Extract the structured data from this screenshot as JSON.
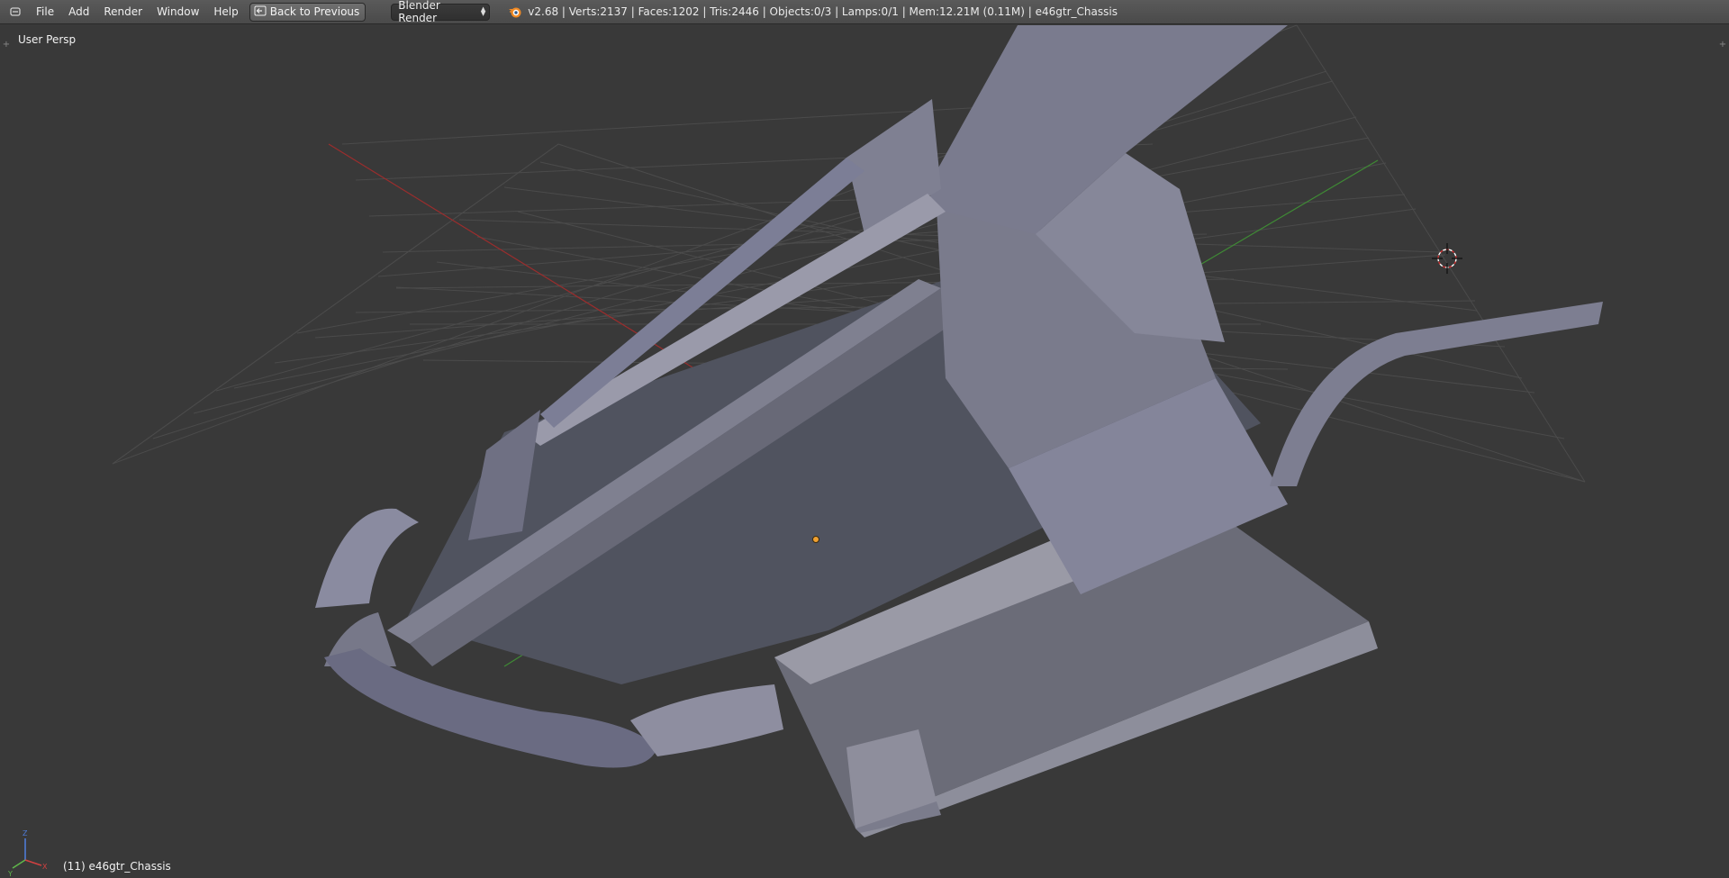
{
  "menu": {
    "file": "File",
    "add": "Add",
    "render": "Render",
    "window": "Window",
    "help": "Help",
    "back_button": "Back to Previous"
  },
  "render_engine": {
    "selected": "Blender Render"
  },
  "stats_text": "v2.68 | Verts:2137 | Faces:1202 | Tris:2446 | Objects:0/3 | Lamps:0/1 | Mem:12.21M (0.11M) | e46gtr_Chassis",
  "viewport": {
    "view_name": "User Persp",
    "object_info": "(11) e46gtr_Chassis",
    "axis_labels": {
      "x": "X",
      "y": "Y",
      "z": "Z"
    }
  },
  "icons": [
    "editor-type-icon",
    "back-arrow-icon",
    "blender-logo-icon",
    "3d-cursor-icon",
    "origin-dot-icon",
    "axis-gizmo-icon"
  ],
  "colors": {
    "header_bg": "#4d4d4d",
    "viewport_bg": "#393939",
    "grid": "#4a4a4a",
    "x_axis": "#a23030",
    "y_axis": "#4a8a3a",
    "mesh_light": "#8e8e9c",
    "mesh_dark": "#4a4d5c"
  }
}
